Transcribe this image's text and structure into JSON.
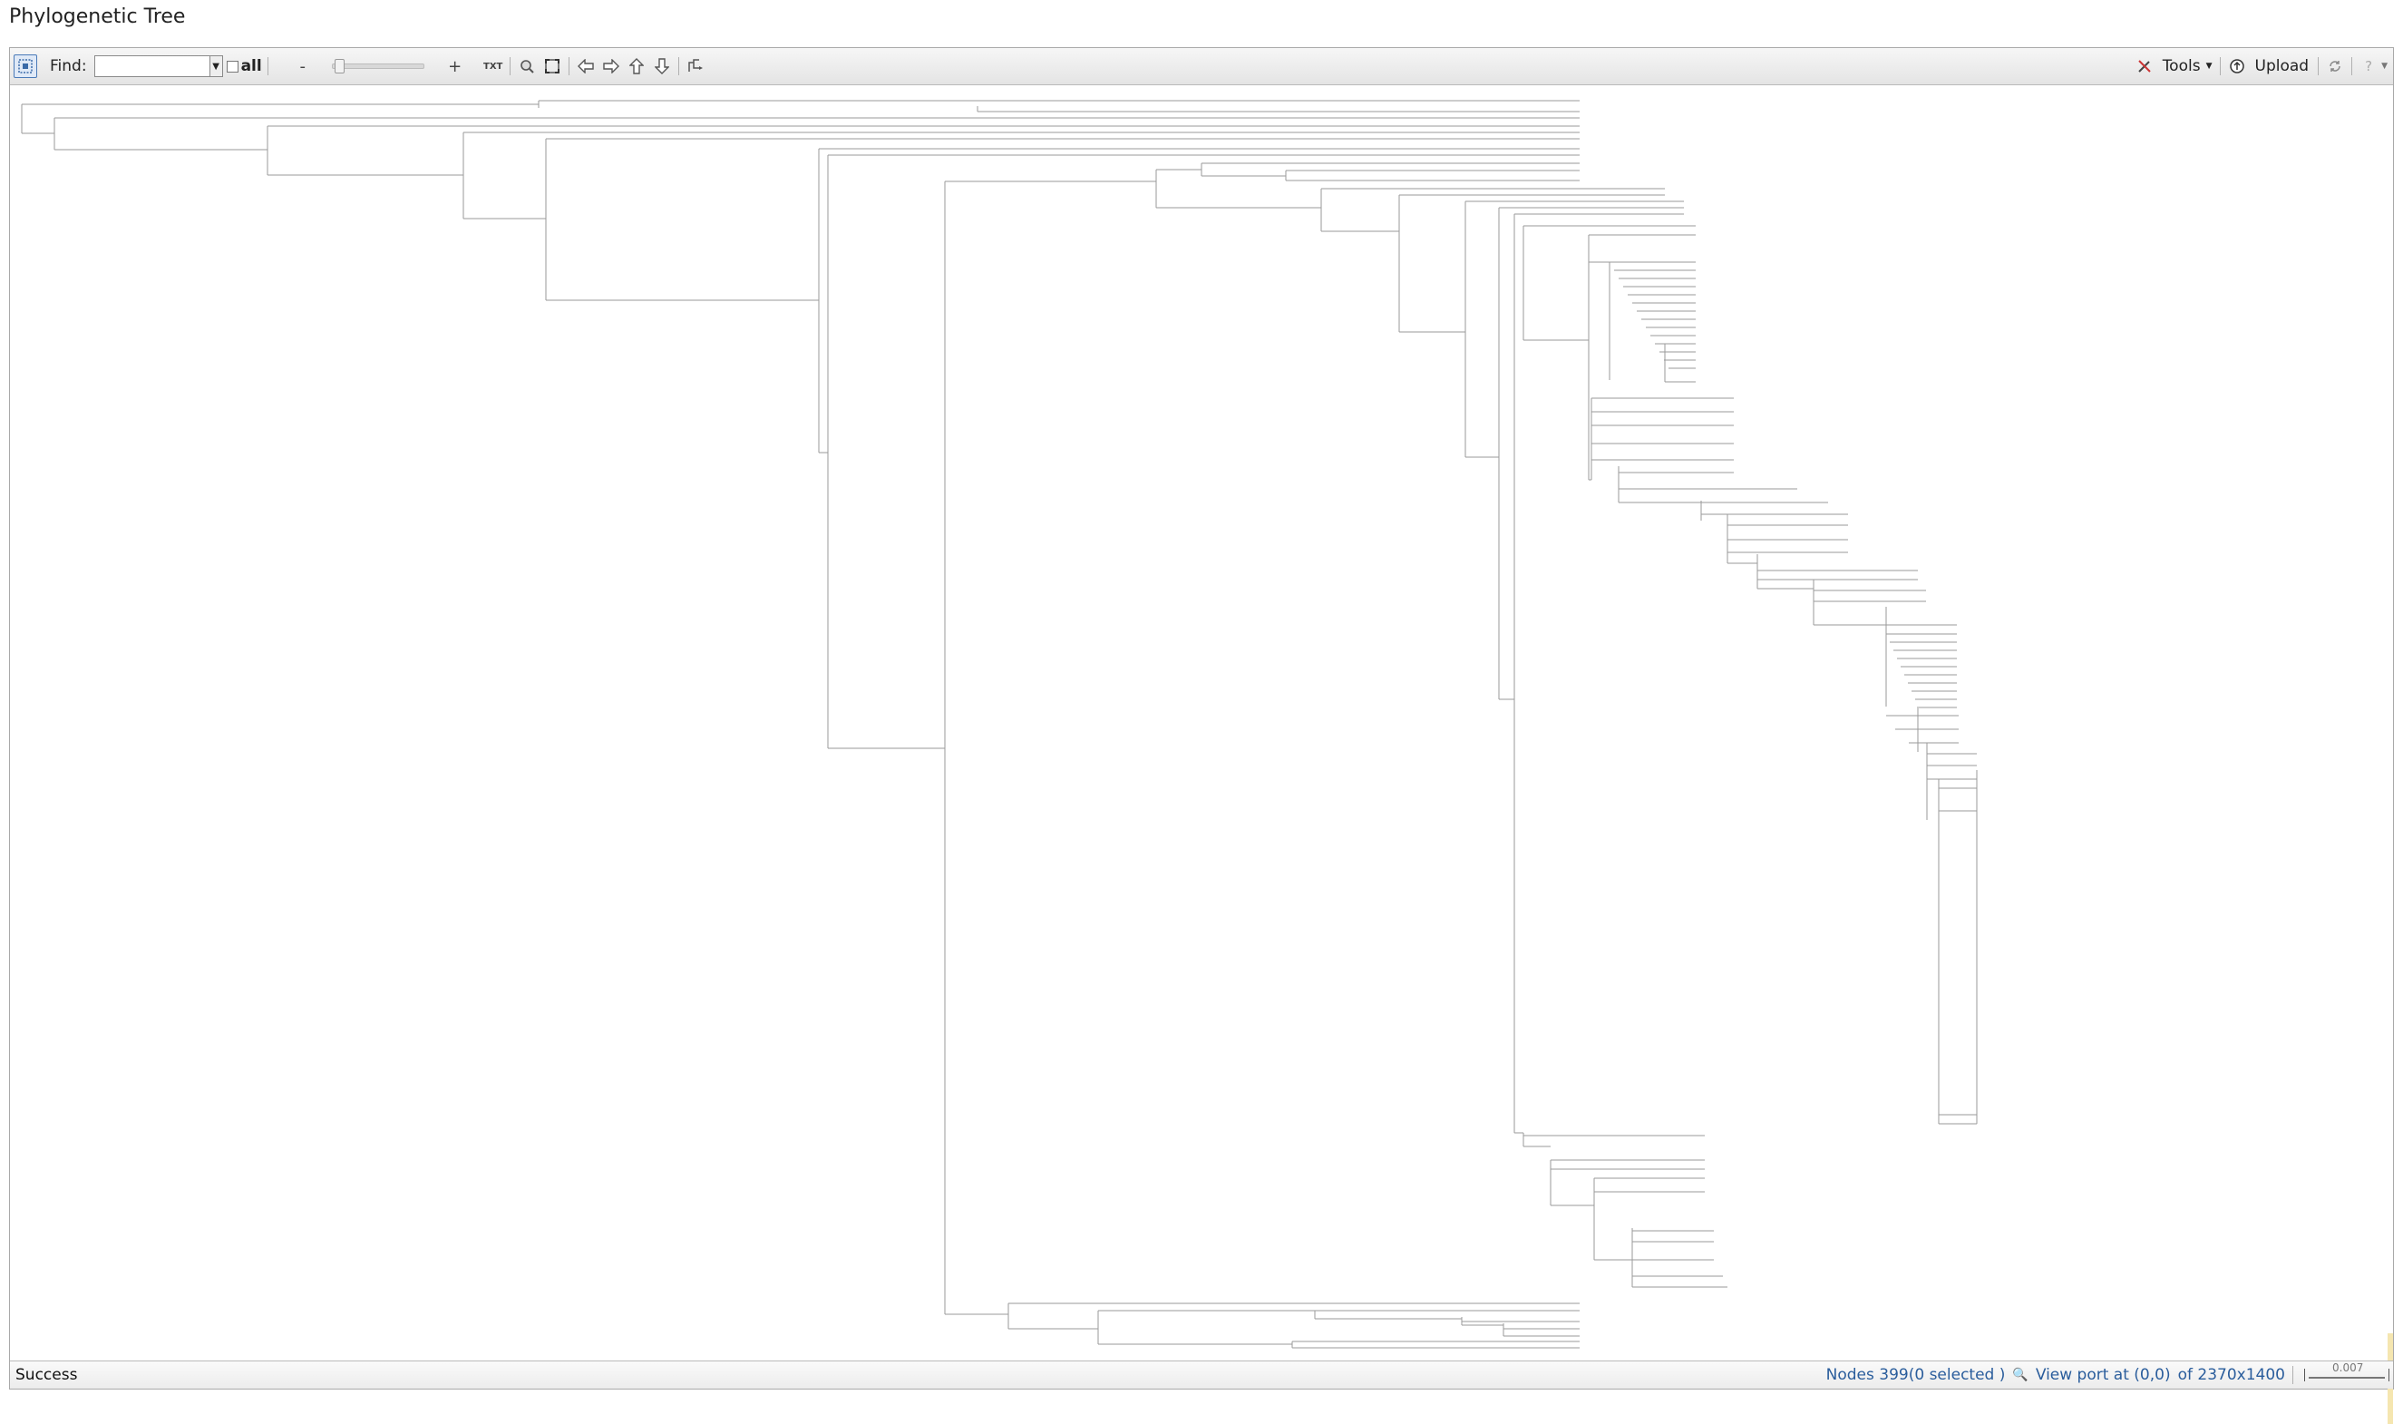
{
  "page": {
    "title": "Phylogenetic Tree"
  },
  "toolbar": {
    "find_label": "Find:",
    "find_value": "",
    "all_label": "all",
    "zoom_out_label": "-",
    "zoom_in_label": "+",
    "zoom_level": 0.05,
    "txt_label": "TXT",
    "tools_label": "Tools",
    "upload_label": "Upload"
  },
  "tree": {
    "node_count": 399,
    "stroke_color": "#9a9a9a"
  },
  "status": {
    "message": "Success",
    "nodes": "Nodes 399(0 selected )",
    "viewport": "View port at (0,0)",
    "canvas": "of 2370x1400",
    "scale": "0.007"
  }
}
